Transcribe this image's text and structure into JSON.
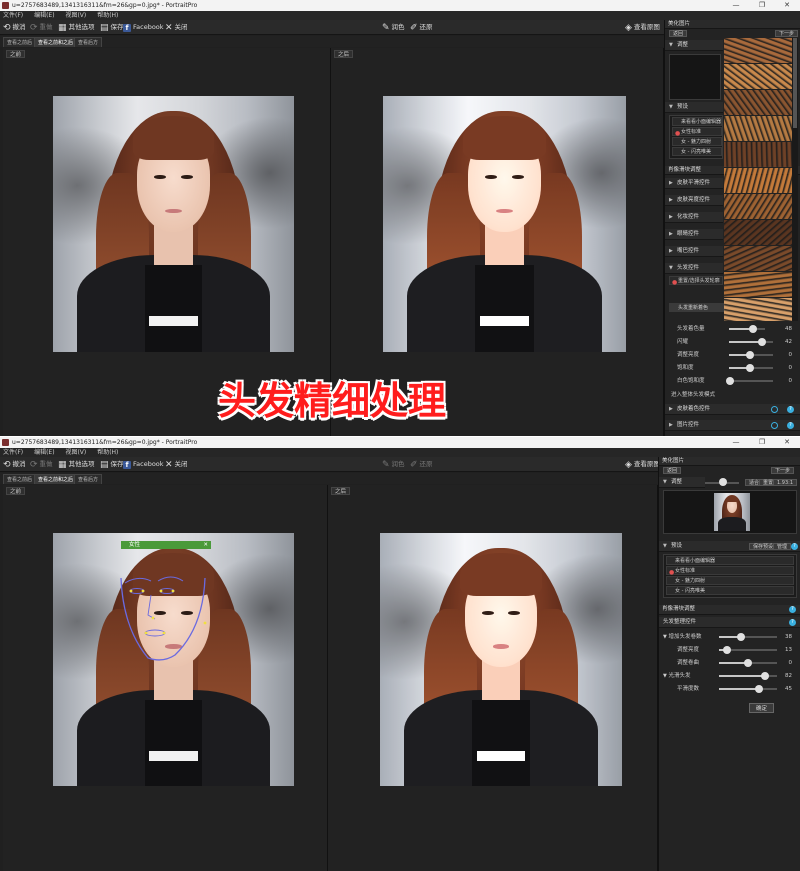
{
  "window": {
    "title": "u=2757683489,1341316311&fm=26&gp=0.jpg* - PortraitPro",
    "controls": [
      "—",
      "❐",
      "✕"
    ]
  },
  "menu": [
    "文件(F)",
    "编辑(E)",
    "视图(V)",
    "帮助(H)"
  ],
  "toolbar": {
    "undo": "撤消",
    "redo": "重做",
    "other_buttons": "其他选项",
    "save": "保存",
    "facebook": "Facebook",
    "close": "关闭",
    "pick_color": "润色",
    "restore": "还原",
    "view_original": "查看原图"
  },
  "tabs": [
    "查看之前后",
    "查看之前和之后",
    "查看后方"
  ],
  "panes": {
    "before": "之前",
    "after": "之后"
  },
  "caption": "头发精细处理",
  "face_tag": {
    "label": "女性",
    "close": "✕"
  },
  "panel1": {
    "header": "美化图片",
    "back": "返回",
    "next": "下一步",
    "browse_label": "调整",
    "presets_label": "预设",
    "presets": [
      "来看看小面编辑器",
      "女性标准",
      "女 - 魅力四射",
      "女 - 闪亮唯美"
    ],
    "effects_header": "肖像滑块调整",
    "sections": [
      "皮肤平滑控件",
      "皮肤亮度控件",
      "化妆控件",
      "眼睛控件",
      "嘴巴控件",
      "头发控件"
    ],
    "hair_subitem": "重置/选择头发轮廓",
    "recolor_label": "头发重新着色",
    "sliders": [
      {
        "label": "头发着色量",
        "value": "48"
      },
      {
        "label": "闪耀",
        "value": "42"
      },
      {
        "label": "调整亮度",
        "value": "0"
      },
      {
        "label": "饱和度",
        "value": "0"
      },
      {
        "label": "白色饱和度",
        "value": "0"
      }
    ],
    "mode_label": "进入整体头发模式",
    "bottom_sections": [
      "皮肤着色控件",
      "图片控件"
    ]
  },
  "panel2": {
    "header": "美化图片",
    "back": "返回",
    "next": "下一步",
    "browse_label": "调整",
    "zoom_controls": [
      "适合",
      "重置",
      "1.93:1"
    ],
    "presets_label": "预设",
    "preset_buttons": [
      "保存预设",
      "管理"
    ],
    "presets": [
      "来看看小面编辑器",
      "女性标准",
      "女 - 魅力四射",
      "女 - 闪亮唯美"
    ],
    "effects_header": "肖像滑块调整",
    "group_label": "头发整理控件",
    "sliders": [
      {
        "label": "增加头发卷数",
        "value": "38",
        "indent": 1
      },
      {
        "label": "调整亮度",
        "value": "13",
        "indent": 2
      },
      {
        "label": "调整卷曲",
        "value": "0",
        "indent": 2
      },
      {
        "label": "光滑头发",
        "value": "82",
        "indent": 1
      },
      {
        "label": "平滑度数",
        "value": "45",
        "indent": 2
      }
    ],
    "done": "确定"
  },
  "swatch_colors": [
    "#a96a3c",
    "#c9894c",
    "#8a5530",
    "#b57a42",
    "#6e4127",
    "#c47a3a",
    "#9e6232",
    "#5a3520",
    "#7a4a2a",
    "#b0703a",
    "#d8a06a"
  ]
}
